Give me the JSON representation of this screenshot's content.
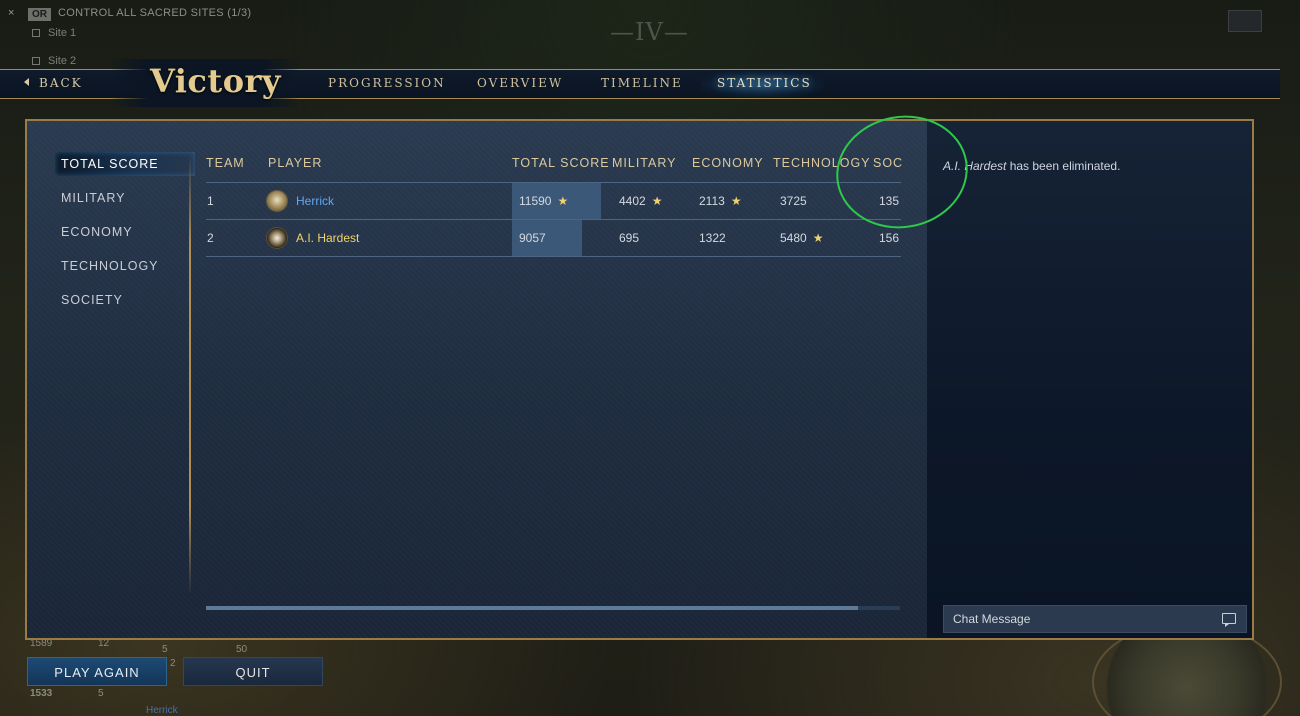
{
  "background": {
    "objective": {
      "close_glyph": "×",
      "or_label": "OR",
      "text": "CONTROL ALL SACRED SITES (1/3)",
      "sites": [
        "Site 1",
        "Site 2"
      ]
    },
    "age_numeral": "—IV—",
    "hud": {
      "stat_a": "1589",
      "stat_b": "12",
      "stat_c": "5",
      "stat_d": "50",
      "stat_e": "2",
      "stat_f": "1533",
      "stat_g": "5",
      "player_label": "Herrick"
    }
  },
  "topbar": {
    "back_label": "BACK",
    "title": "Victory",
    "tabs": [
      {
        "label": "PROGRESSION",
        "active": false
      },
      {
        "label": "OVERVIEW",
        "active": false
      },
      {
        "label": "TIMELINE",
        "active": false
      },
      {
        "label": "STATISTICS",
        "active": true
      }
    ]
  },
  "sidebar": {
    "categories": [
      {
        "label": "TOTAL SCORE",
        "active": true
      },
      {
        "label": "MILITARY",
        "active": false
      },
      {
        "label": "ECONOMY",
        "active": false
      },
      {
        "label": "TECHNOLOGY",
        "active": false
      },
      {
        "label": "SOCIETY",
        "active": false
      }
    ]
  },
  "table": {
    "headers": {
      "team": "TEAM",
      "player": "PLAYER",
      "total_score": "TOTAL SCORE",
      "military": "MILITARY",
      "economy": "ECONOMY",
      "technology": "TECHNOLOGY",
      "society": "SOC"
    },
    "rows": [
      {
        "team": "1",
        "player": "Herrick",
        "player_style": "human",
        "total_score": "11590",
        "total_score_star": true,
        "military": "4402",
        "military_star": true,
        "economy": "2113",
        "economy_star": true,
        "technology": "3725",
        "technology_star": false,
        "society": "135"
      },
      {
        "team": "2",
        "player": "A.I. Hardest",
        "player_style": "ai",
        "total_score": "9057",
        "total_score_star": false,
        "military": "695",
        "military_star": false,
        "economy": "1322",
        "economy_star": false,
        "technology": "5480",
        "technology_star": true,
        "society": "156"
      }
    ],
    "star_glyph": "★"
  },
  "chat": {
    "message_name": "A.I. Hardest",
    "message_text": " has been eliminated.",
    "input_placeholder": "Chat Message"
  },
  "buttons": {
    "play_again": "PLAY AGAIN",
    "quit": "QUIT"
  },
  "colors": {
    "accent_gold": "#e3ca8f",
    "frame_gold": "#9c7c45",
    "human_player": "#5fa8f0",
    "ai_player": "#f0d46a",
    "annotation_green": "#2ec84a",
    "star": "#f0d070"
  }
}
